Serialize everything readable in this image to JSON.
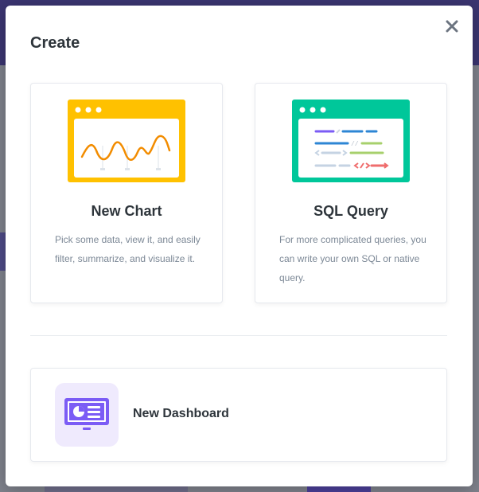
{
  "modal": {
    "title": "Create",
    "close_icon": "close-icon"
  },
  "options": {
    "new_chart": {
      "title": "New Chart",
      "description": "Pick some data, view it, and easily filter, summarize, and visualize it.",
      "illustration": "chart-window-illustration",
      "accent_color": "#FFC100"
    },
    "sql_query": {
      "title": "SQL Query",
      "description": "For more complicated queries, you can write your own SQL or native query.",
      "illustration": "code-window-illustration",
      "accent_color": "#00C79A"
    },
    "new_dashboard": {
      "title": "New Dashboard",
      "icon": "dashboard-icon",
      "accent_color": "#7B5CF5"
    }
  }
}
